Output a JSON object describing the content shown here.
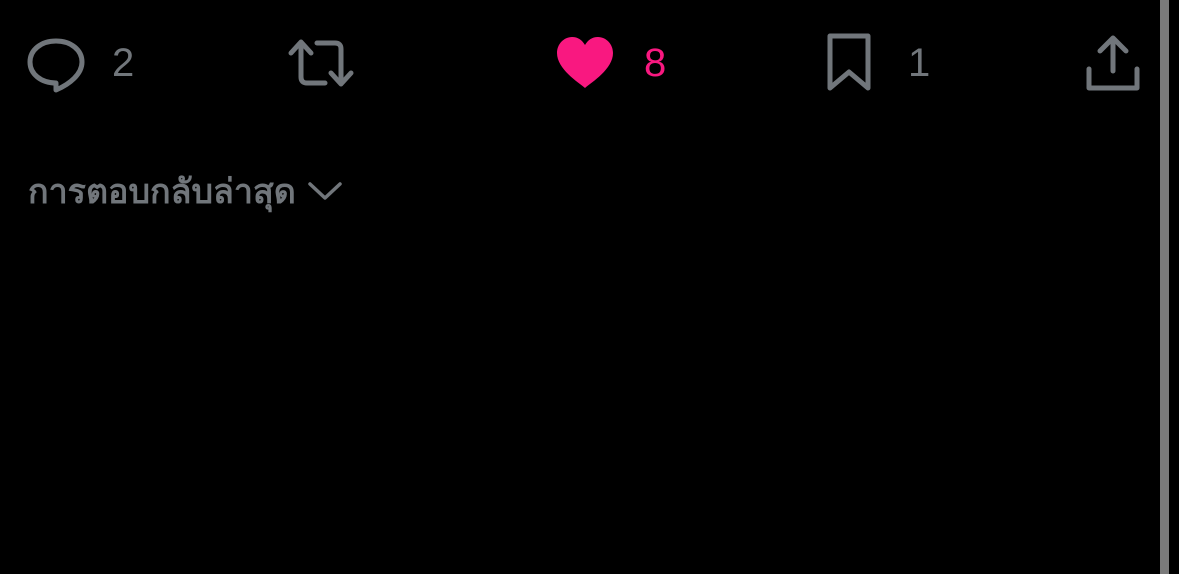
{
  "actions": {
    "reply": {
      "icon": "reply-icon",
      "count": "2"
    },
    "repost": {
      "icon": "repost-icon",
      "count": ""
    },
    "like": {
      "icon": "heart-icon",
      "count": "8",
      "active": true
    },
    "bookmark": {
      "icon": "bookmark-icon",
      "count": "1"
    },
    "share": {
      "icon": "share-icon"
    }
  },
  "sort": {
    "label": "การตอบกลับล่าสุด",
    "icon": "chevron-down-icon"
  },
  "colors": {
    "background": "#000000",
    "muted": "#71767b",
    "like_accent": "#f91880",
    "scrollbar": "#7a7a7a"
  }
}
